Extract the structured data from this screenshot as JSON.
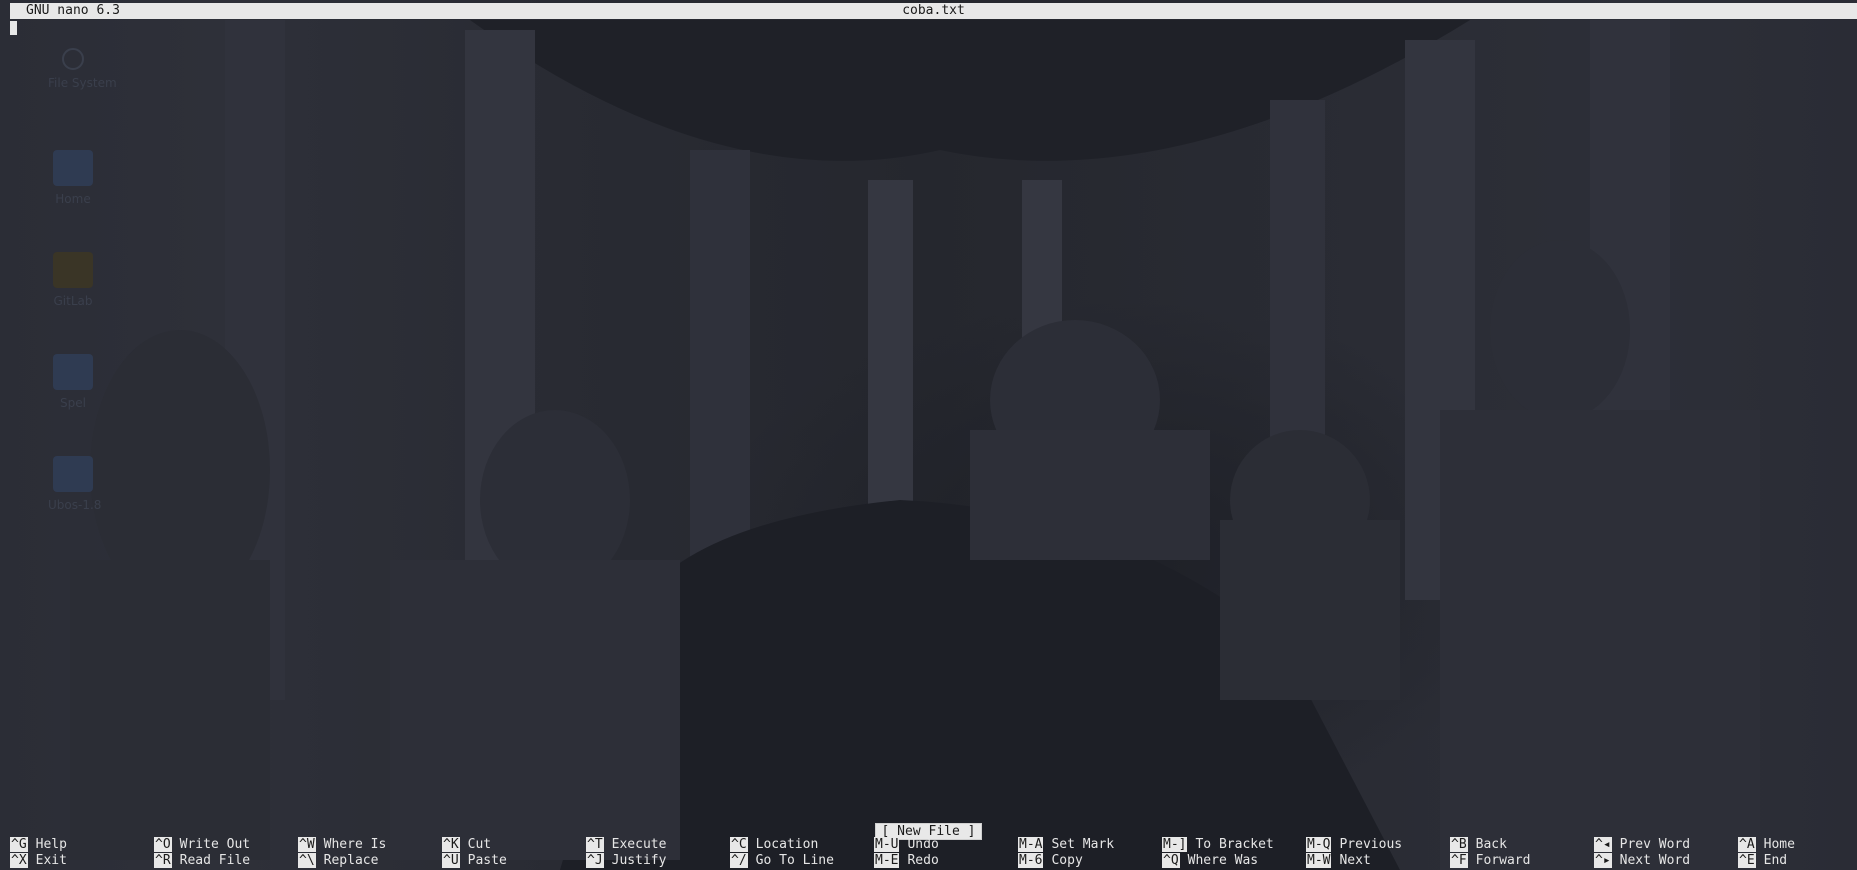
{
  "titlebar": {
    "app": "GNU nano 6.3",
    "filename": "coba.txt"
  },
  "status": "[ New File ]",
  "desktop_icons": [
    {
      "label": "File System",
      "icon": "drive-icon"
    },
    {
      "label": "Home",
      "icon": "home-folder-icon"
    },
    {
      "label": "GitLab",
      "icon": "gitlab-icon"
    },
    {
      "label": "Spel",
      "icon": "folder-icon"
    },
    {
      "label": "Ubos-1.8",
      "icon": "folder-icon"
    }
  ],
  "shortcuts": [
    [
      {
        "key": "^G",
        "label": "Help"
      },
      {
        "key": "^X",
        "label": "Exit"
      }
    ],
    [
      {
        "key": "^O",
        "label": "Write Out"
      },
      {
        "key": "^R",
        "label": "Read File"
      }
    ],
    [
      {
        "key": "^W",
        "label": "Where Is"
      },
      {
        "key": "^\\",
        "label": "Replace"
      }
    ],
    [
      {
        "key": "^K",
        "label": "Cut"
      },
      {
        "key": "^U",
        "label": "Paste"
      }
    ],
    [
      {
        "key": "^T",
        "label": "Execute"
      },
      {
        "key": "^J",
        "label": "Justify"
      }
    ],
    [
      {
        "key": "^C",
        "label": "Location"
      },
      {
        "key": "^/",
        "label": "Go To Line"
      }
    ],
    [
      {
        "key": "M-U",
        "label": "Undo"
      },
      {
        "key": "M-E",
        "label": "Redo"
      }
    ],
    [
      {
        "key": "M-A",
        "label": "Set Mark"
      },
      {
        "key": "M-6",
        "label": "Copy"
      }
    ],
    [
      {
        "key": "M-]",
        "label": "To Bracket"
      },
      {
        "key": "^Q",
        "label": "Where Was"
      }
    ],
    [
      {
        "key": "M-Q",
        "label": "Previous"
      },
      {
        "key": "M-W",
        "label": "Next"
      }
    ],
    [
      {
        "key": "^B",
        "label": "Back"
      },
      {
        "key": "^F",
        "label": "Forward"
      }
    ],
    [
      {
        "key": "^◂",
        "label": "Prev Word"
      },
      {
        "key": "^▸",
        "label": "Next Word"
      }
    ],
    [
      {
        "key": "^A",
        "label": "Home"
      },
      {
        "key": "^E",
        "label": "End"
      }
    ]
  ]
}
